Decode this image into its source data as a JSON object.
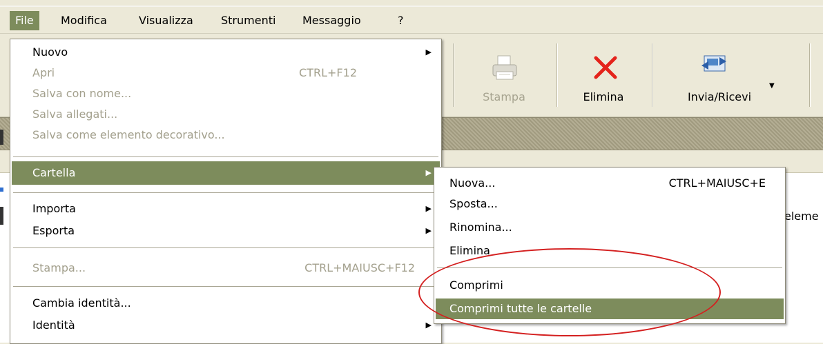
{
  "menubar": {
    "items": [
      "File",
      "Modifica",
      "Visualizza",
      "Strumenti",
      "Messaggio",
      "?"
    ]
  },
  "toolbar": {
    "print_label": "Stampa",
    "delete_label": "Elimina",
    "send_receive_label": "Invia/Ricevi"
  },
  "content": {
    "fragment": "eleme"
  },
  "file_menu": {
    "items": [
      {
        "label": "Nuovo",
        "shortcut": "",
        "submenu": true,
        "disabled": false
      },
      {
        "label": "Apri",
        "shortcut": "CTRL+F12",
        "disabled": true
      },
      {
        "label": "Salva con nome...",
        "shortcut": "",
        "disabled": true
      },
      {
        "label": "Salva allegati...",
        "shortcut": "",
        "disabled": true
      },
      {
        "label": "Salva come elemento decorativo...",
        "shortcut": "",
        "disabled": true
      },
      {
        "label": "Cartella",
        "shortcut": "",
        "submenu": true,
        "highlighted": true
      },
      {
        "label": "Importa",
        "shortcut": "",
        "submenu": true
      },
      {
        "label": "Esporta",
        "shortcut": "",
        "submenu": true
      },
      {
        "label": "Stampa...",
        "shortcut": "CTRL+MAIUSC+F12",
        "disabled": true
      },
      {
        "label": "Cambia identità...",
        "shortcut": ""
      },
      {
        "label": "Identità",
        "shortcut": "",
        "submenu": true
      }
    ]
  },
  "folder_submenu": {
    "items": [
      {
        "label": "Nuova...",
        "shortcut": "CTRL+MAIUSC+E"
      },
      {
        "label": "Sposta...",
        "shortcut": ""
      },
      {
        "label": "Rinomina...",
        "shortcut": ""
      },
      {
        "label": "Elimina",
        "shortcut": ""
      },
      {
        "label": "Comprimi",
        "shortcut": ""
      },
      {
        "label": "Comprimi tutte le cartelle",
        "shortcut": "",
        "highlighted": true
      }
    ]
  },
  "colors": {
    "highlight": "#7d8c5c",
    "annotation": "#d42020",
    "chrome": "#ece9d8"
  },
  "icons": {
    "print": "printer-icon",
    "delete": "red-x-icon",
    "send_receive": "send-receive-icon",
    "submenu": "triangle-right-icon"
  }
}
